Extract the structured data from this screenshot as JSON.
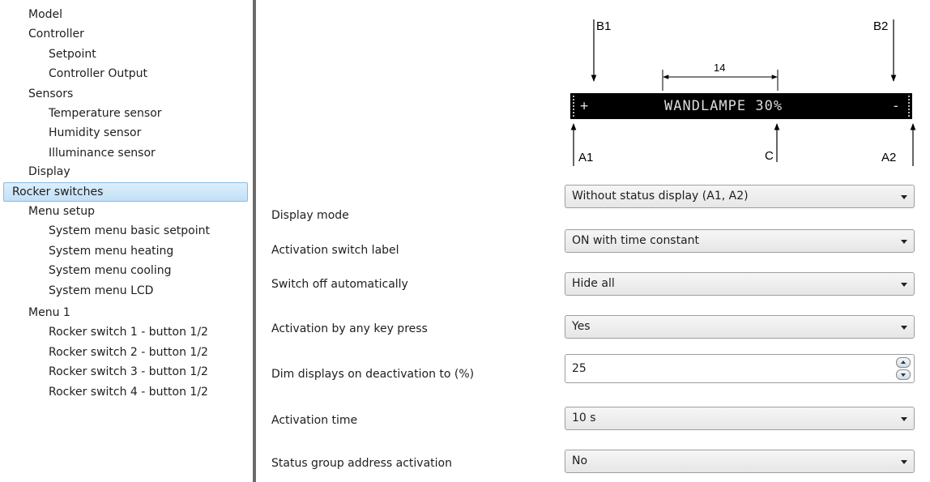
{
  "sidebar": {
    "items": [
      {
        "label": "Model",
        "level": 0
      },
      {
        "label": "Controller",
        "level": 0
      },
      {
        "label": "Setpoint",
        "level": 1
      },
      {
        "label": "Controller Output",
        "level": 1
      },
      {
        "label": "Sensors",
        "level": 0
      },
      {
        "label": "Temperature sensor",
        "level": 1
      },
      {
        "label": "Humidity sensor",
        "level": 1
      },
      {
        "label": "Illuminance sensor",
        "level": 1
      },
      {
        "label": "Display",
        "level": 0
      },
      {
        "label": "Rocker switches",
        "level": 0,
        "selected": true
      },
      {
        "label": "Menu setup",
        "level": 0
      },
      {
        "label": "System menu basic setpoint",
        "level": 1
      },
      {
        "label": "System menu heating",
        "level": 1
      },
      {
        "label": "System menu cooling",
        "level": 1
      },
      {
        "label": "System menu LCD",
        "level": 1
      },
      {
        "label": "Menu 1",
        "level": 0
      },
      {
        "label": "Rocker switch 1 - button 1/2",
        "level": 1
      },
      {
        "label": "Rocker switch 2 - button 1/2",
        "level": 1
      },
      {
        "label": "Rocker switch 3 - button 1/2",
        "level": 1
      },
      {
        "label": "Rocker switch 4 - button 1/2",
        "level": 1
      }
    ]
  },
  "diagram": {
    "b1": "B1",
    "b2": "B2",
    "width_label": "14",
    "lcd_plus": "+",
    "lcd_text": "WANDLAMPE 30%",
    "lcd_minus": "-",
    "a1": "A1",
    "c": "C",
    "a2": "A2"
  },
  "settings": {
    "display_mode": {
      "label": "Display mode",
      "value": "Without status display (A1, A2)"
    },
    "activation_switch_label": {
      "label": "Activation switch label",
      "value": "ON with time constant"
    },
    "switch_off_automatically": {
      "label": "Switch off automatically",
      "value": "Hide all"
    },
    "activation_by_any_key": {
      "label": "Activation by any key press",
      "value": "Yes"
    },
    "dim_displays": {
      "label": "Dim displays on deactivation to (%)",
      "value": "25"
    },
    "activation_time": {
      "label": "Activation time",
      "value": "10 s"
    },
    "status_group_address": {
      "label": "Status group address activation",
      "value": "No"
    }
  },
  "colors": {
    "selection": "#c2e0f8",
    "lcd_background": "#000000",
    "lcd_text": "#dcdcdc"
  }
}
